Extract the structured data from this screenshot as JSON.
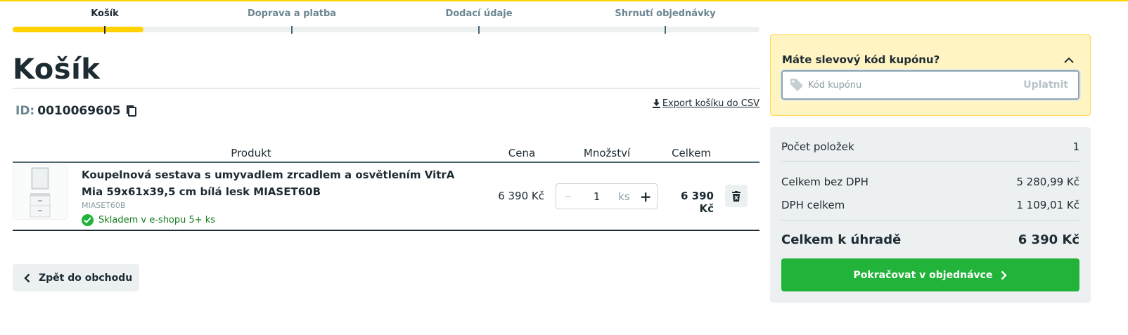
{
  "stepper": {
    "steps": [
      {
        "label": "Košík",
        "active": true
      },
      {
        "label": "Doprava a platba",
        "active": false
      },
      {
        "label": "Dodací údaje",
        "active": false
      },
      {
        "label": "Shrnutí objednávky",
        "active": false
      }
    ],
    "progress_percent": 17.5
  },
  "page": {
    "title": "Košík",
    "id_label": "ID:",
    "id_value": "0010069605",
    "export_label": "Export košíku do CSV"
  },
  "table": {
    "headers": {
      "product": "Produkt",
      "price": "Cena",
      "quantity": "Množství",
      "total": "Celkem"
    },
    "items": [
      {
        "name": "Koupelnová sestava s umyvadlem zrcadlem a osvětlením VitrA Mia 59x61x39,5 cm bílá lesk MIASET60B",
        "code": "MIASET60B",
        "stock": "Skladem v e-shopu 5+ ks",
        "price": "6 390 Kč",
        "quantity": "1",
        "unit": "ks",
        "total": "6 390 Kč"
      }
    ]
  },
  "back_button": {
    "label": "Zpět do obchodu"
  },
  "coupon": {
    "title": "Máte slevový kód kupónu?",
    "placeholder": "Kód kupónu",
    "apply_label": "Uplatnit"
  },
  "summary": {
    "count_label": "Počet položek",
    "count_value": "1",
    "net_label": "Celkem bez DPH",
    "net_value": "5 280,99 Kč",
    "vat_label": "DPH celkem",
    "vat_value": "1 109,01 Kč",
    "total_label": "Celkem k úhradě",
    "total_value": "6 390 Kč",
    "continue_label": "Pokračovat v objednávce"
  },
  "colors": {
    "accent_yellow": "#ffd200",
    "primary_green": "#22b33a",
    "text_dark": "#1d2b33",
    "muted": "#6b8591"
  }
}
